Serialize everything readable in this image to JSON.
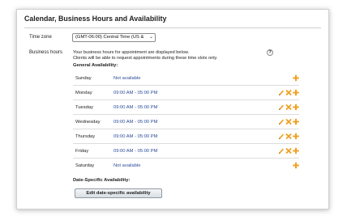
{
  "section": {
    "title": "Calendar, Business Hours and Availability"
  },
  "timezone": {
    "label": "Time zone",
    "value": "(GMT-06:00) Central Time (US &"
  },
  "business_hours": {
    "label": "Business hours",
    "description_line1": "Your business hours for appointment are displayed below.",
    "description_line2": "Clients will be able to request appointments during these time slots only.",
    "help_symbol": "?"
  },
  "general_availability": {
    "heading": "General Availability:",
    "days": [
      {
        "day": "Sunday",
        "hours": "Not available",
        "editable": false
      },
      {
        "day": "Monday",
        "hours": "09:00 AM - 05:00 PM",
        "editable": true
      },
      {
        "day": "Tuesday",
        "hours": "09:00 AM - 05:00 PM",
        "editable": true
      },
      {
        "day": "Wednesday",
        "hours": "09:00 AM - 05:00 PM",
        "editable": true
      },
      {
        "day": "Thursday",
        "hours": "09:00 AM - 05:00 PM",
        "editable": true
      },
      {
        "day": "Friday",
        "hours": "09:00 AM - 05:00 PM",
        "editable": true
      },
      {
        "day": "Saturday",
        "hours": "Not available",
        "editable": false
      }
    ]
  },
  "date_specific": {
    "heading": "Date-Specific Availability:",
    "button_label": "Edit date-specific availability"
  },
  "icons": {
    "edit": "pencil-icon",
    "delete": "x-icon",
    "add": "plus-icon"
  },
  "colors": {
    "hours_link": "#2b4d9a",
    "icon_orange": "#f0a020"
  }
}
